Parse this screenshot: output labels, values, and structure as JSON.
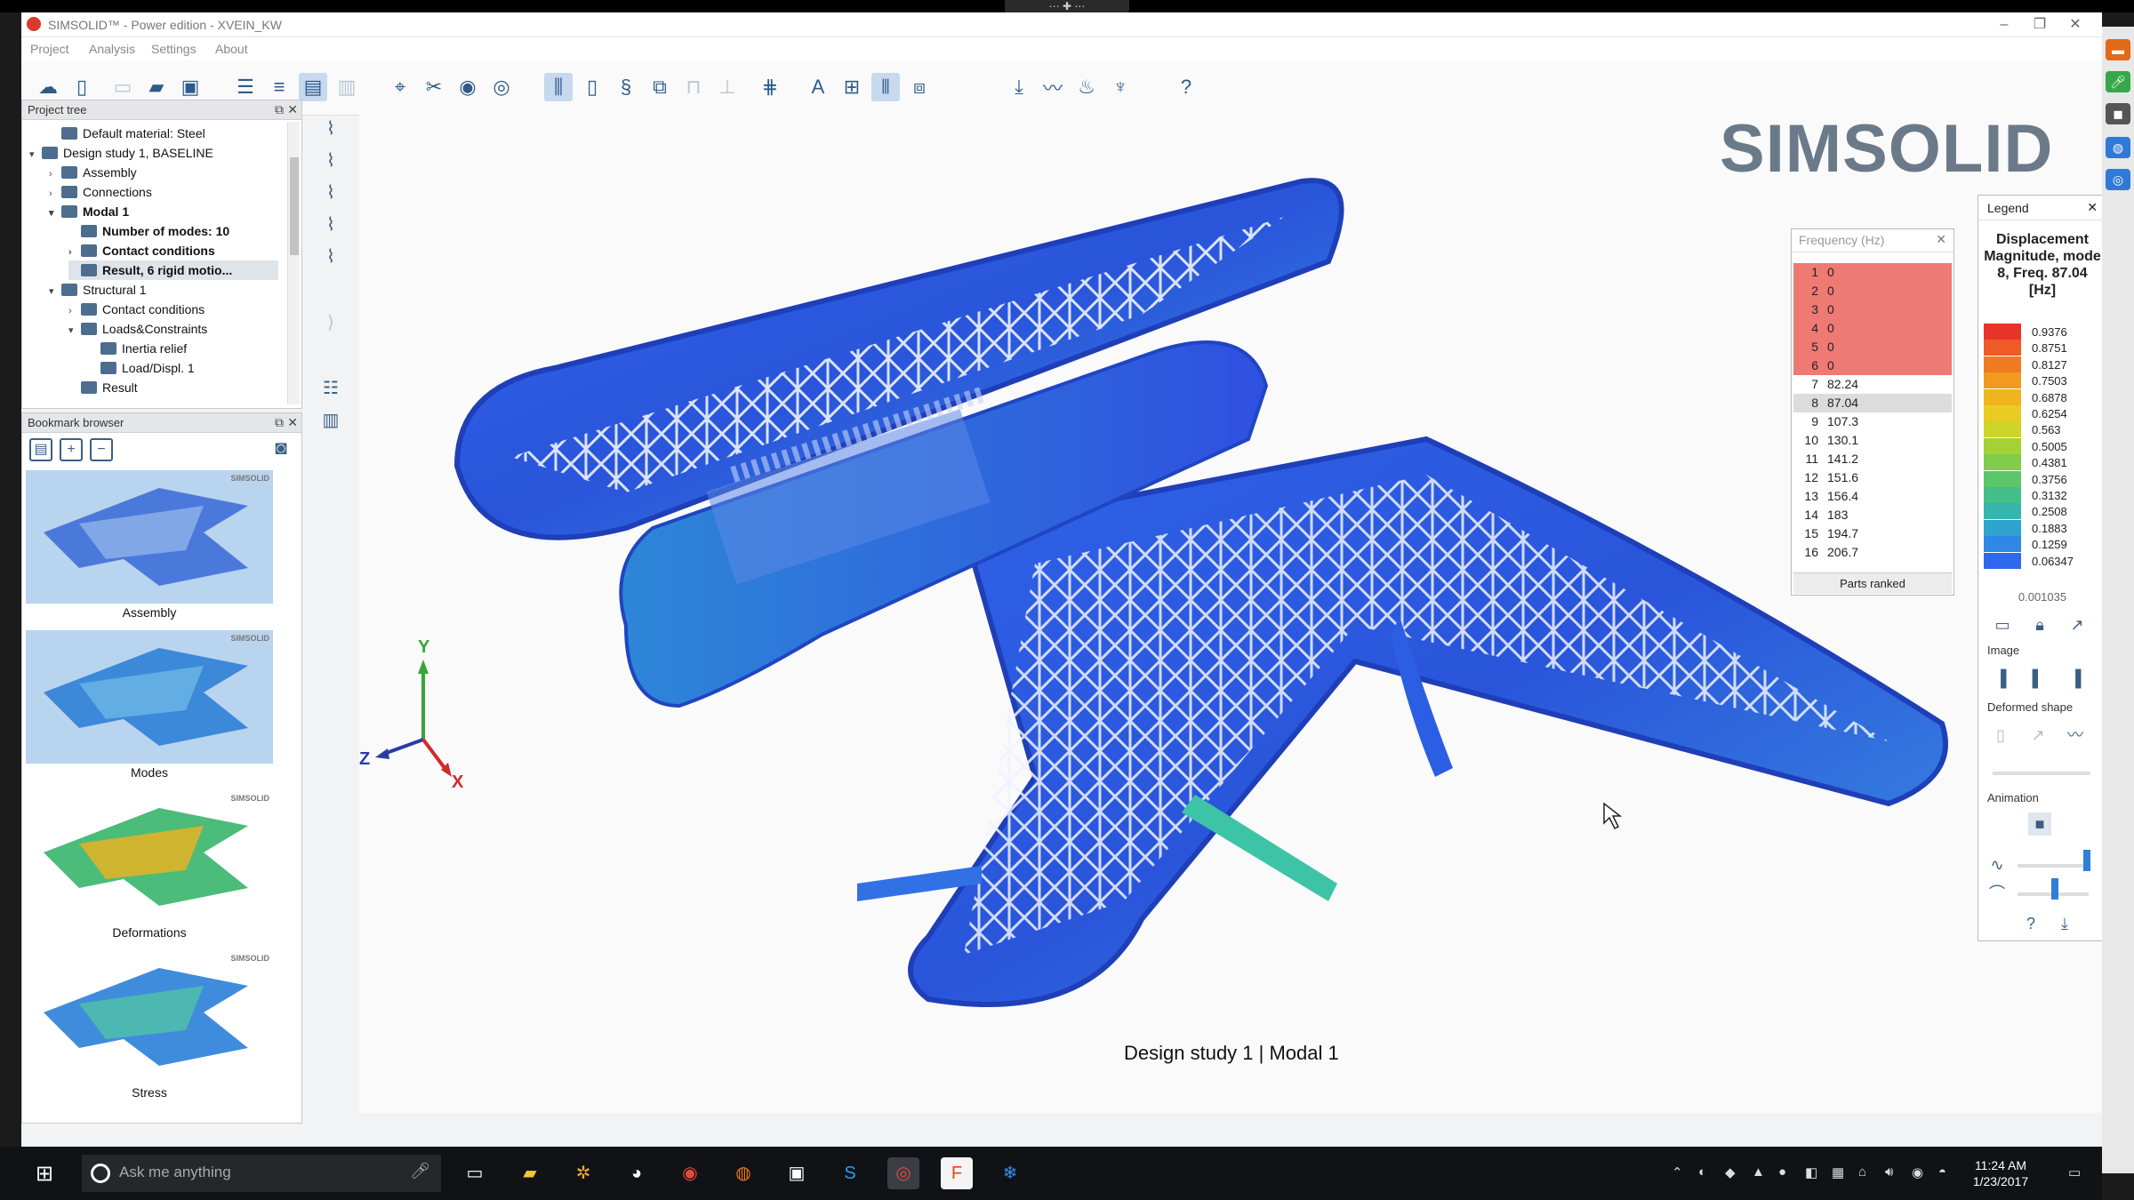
{
  "window": {
    "title": "SIMSOLID™ - Power edition - XVEIN_KW",
    "menus": [
      "Project",
      "Analysis",
      "Settings",
      "About"
    ]
  },
  "project_tree": {
    "title": "Project tree",
    "items": [
      {
        "label": "Default material: Steel",
        "level": 1,
        "expander": "",
        "bold": false
      },
      {
        "label": "Design study 1, BASELINE",
        "level": 0,
        "expander": "v",
        "bold": false
      },
      {
        "label": "Assembly",
        "level": 1,
        "expander": ">",
        "bold": false
      },
      {
        "label": "Connections",
        "level": 1,
        "expander": ">",
        "bold": false
      },
      {
        "label": "Modal 1",
        "level": 1,
        "expander": "v",
        "bold": true
      },
      {
        "label": "Number of modes: 10",
        "level": 2,
        "expander": "",
        "bold": true
      },
      {
        "label": "Contact conditions",
        "level": 2,
        "expander": ">",
        "bold": true
      },
      {
        "label": "Result, 6 rigid motio...",
        "level": 2,
        "expander": "",
        "bold": true
      },
      {
        "label": "Structural 1",
        "level": 1,
        "expander": "v",
        "bold": false
      },
      {
        "label": "Contact conditions",
        "level": 2,
        "expander": ">",
        "bold": false
      },
      {
        "label": "Loads&Constraints",
        "level": 2,
        "expander": "v",
        "bold": false
      },
      {
        "label": "Inertia relief",
        "level": 3,
        "expander": "",
        "bold": false
      },
      {
        "label": "Load/Displ. 1",
        "level": 3,
        "expander": "",
        "bold": false
      },
      {
        "label": "Result",
        "level": 2,
        "expander": "",
        "bold": false
      }
    ]
  },
  "bookmarks": {
    "title": "Bookmark browser",
    "brand": "SIMSOLID",
    "cards": [
      "Assembly",
      "Modes",
      "Deformations",
      "Stress"
    ]
  },
  "viewport": {
    "brand": "SIMSOLID",
    "caption": "Design study 1 | Modal 1",
    "axes": {
      "x": "X",
      "y": "Y",
      "z": "Z"
    }
  },
  "frequency": {
    "title": "Frequency (Hz)",
    "rows": [
      {
        "n": "1",
        "v": "0"
      },
      {
        "n": "2",
        "v": "0"
      },
      {
        "n": "3",
        "v": "0"
      },
      {
        "n": "4",
        "v": "0"
      },
      {
        "n": "5",
        "v": "0"
      },
      {
        "n": "6",
        "v": "0"
      },
      {
        "n": "7",
        "v": "82.24"
      },
      {
        "n": "8",
        "v": "87.04"
      },
      {
        "n": "9",
        "v": "107.3"
      },
      {
        "n": "10",
        "v": "130.1"
      },
      {
        "n": "11",
        "v": "141.2"
      },
      {
        "n": "12",
        "v": "151.6"
      },
      {
        "n": "13",
        "v": "156.4"
      },
      {
        "n": "14",
        "v": "183"
      },
      {
        "n": "15",
        "v": "194.7"
      },
      {
        "n": "16",
        "v": "206.7"
      }
    ],
    "footer": "Parts ranked"
  },
  "legend": {
    "title": "Legend",
    "heading": "Displacement Magnitude, mode 8, Freq. 87.04 [Hz]",
    "values": [
      "0.9376",
      "0.8751",
      "0.8127",
      "0.7503",
      "0.6878",
      "0.6254",
      "0.563",
      "0.5005",
      "0.4381",
      "0.3756",
      "0.3132",
      "0.2508",
      "0.1883",
      "0.1259",
      "0.06347"
    ],
    "colors": [
      "#e8332a",
      "#ef5a26",
      "#f07a22",
      "#f29a1f",
      "#f0b51e",
      "#eacb22",
      "#cfd428",
      "#a4d232",
      "#7fcd4a",
      "#5cc66a",
      "#44bf8a",
      "#35b5ad",
      "#2fa3cf",
      "#2f87e6",
      "#2f68ee"
    ],
    "min_value": "0.001035",
    "image_label": "Image",
    "deformed_label": "Deformed shape",
    "animation_label": "Animation"
  },
  "taskbar": {
    "search_placeholder": "Ask me anything",
    "time": "11:24 AM",
    "date": "1/23/2017"
  }
}
